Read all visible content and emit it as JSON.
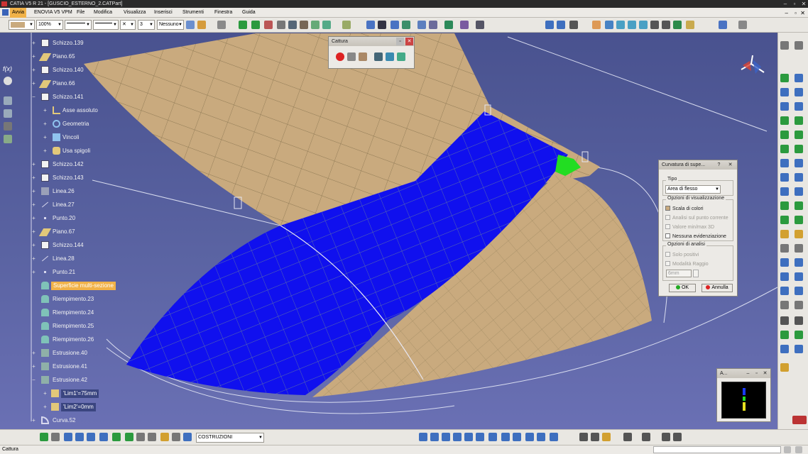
{
  "window": {
    "title": "CATIA V5 R 21 - [GUSCIO_ESTERNO_2.CATPart]"
  },
  "menu": [
    "Avvia",
    "ENOVIA V5 VPM",
    "File",
    "Modifica",
    "Visualizza",
    "Inserisci",
    "Strumenti",
    "Finestra",
    "Guida"
  ],
  "toolbar": {
    "zoom": "100%",
    "layer": "Nessuno",
    "weight": "3"
  },
  "tree": [
    {
      "label": "Schizzo.139",
      "icon": "sketch-icon"
    },
    {
      "label": "Piano.65",
      "icon": "plane-icon"
    },
    {
      "label": "Schizzo.140",
      "icon": "sketch-icon"
    },
    {
      "label": "Piano.66",
      "icon": "plane-icon"
    },
    {
      "label": "Schizzo.141",
      "icon": "sketch-icon"
    },
    {
      "label": "Asse assoluto",
      "icon": "axis-icon"
    },
    {
      "label": "Geometria",
      "icon": "geometry-icon"
    },
    {
      "label": "Vincoli",
      "icon": "constraints-icon"
    },
    {
      "label": "Usa spigoli",
      "icon": "use-edges-icon"
    },
    {
      "label": "Schizzo.142",
      "icon": "sketch-icon"
    },
    {
      "label": "Schizzo.143",
      "icon": "sketch-icon"
    },
    {
      "label": "Linea.26",
      "icon": "line-icon"
    },
    {
      "label": "Linea.27",
      "icon": "line-icon"
    },
    {
      "label": "Punto.20",
      "icon": "point-icon"
    },
    {
      "label": "Piano.67",
      "icon": "plane-icon"
    },
    {
      "label": "Schizzo.144",
      "icon": "sketch-icon"
    },
    {
      "label": "Linea.28",
      "icon": "line-icon"
    },
    {
      "label": "Punto.21",
      "icon": "point-icon"
    },
    {
      "label": "Superficie multi-sezione",
      "icon": "multi-section-surface-icon",
      "selected": true
    },
    {
      "label": "Riempimento.23",
      "icon": "fill-icon"
    },
    {
      "label": "Riempimento.24",
      "icon": "fill-icon"
    },
    {
      "label": "Riempimento.25",
      "icon": "fill-icon"
    },
    {
      "label": "Riempimento.26",
      "icon": "fill-icon"
    },
    {
      "label": "Estrusione.40",
      "icon": "extrude-icon"
    },
    {
      "label": "Estrusione.41",
      "icon": "extrude-icon"
    },
    {
      "label": "Estrusione.42",
      "icon": "extrude-icon"
    },
    {
      "label": "'Lim1'=75mm",
      "icon": "limit-icon"
    },
    {
      "label": "'Lim2'=0mm",
      "icon": "limit-icon"
    },
    {
      "label": "Curva.52",
      "icon": "curve-icon"
    }
  ],
  "cattura": {
    "title": "Cattura"
  },
  "curvatura": {
    "title": "Curvatura di supe...",
    "help": "?",
    "tipo_label": "Tipo",
    "tipo_value": "Area di flesso",
    "vis_label": "Opzioni di visualizzazione",
    "vis_options": [
      "Scala di colori",
      "Analisi sul punto corrente",
      "Valore min/max 3D",
      "Nessuna evidenziazione"
    ],
    "analysis_label": "Opzioni di analisi",
    "analysis_options": [
      "Solo positivi",
      "Modalità Raggio"
    ],
    "step_value": "6mm",
    "ok": "OK",
    "cancel": "Annulla"
  },
  "preview": {
    "title": "A..."
  },
  "bottombar": {
    "set_value": "COSTRUZIONI"
  },
  "status": {
    "text": "Cattura"
  },
  "colors": {
    "surface_beige": "#c9aa7e",
    "inflection_blue": "#1010ee",
    "highlight_green": "#22dd22",
    "selection": "#f1b248"
  }
}
